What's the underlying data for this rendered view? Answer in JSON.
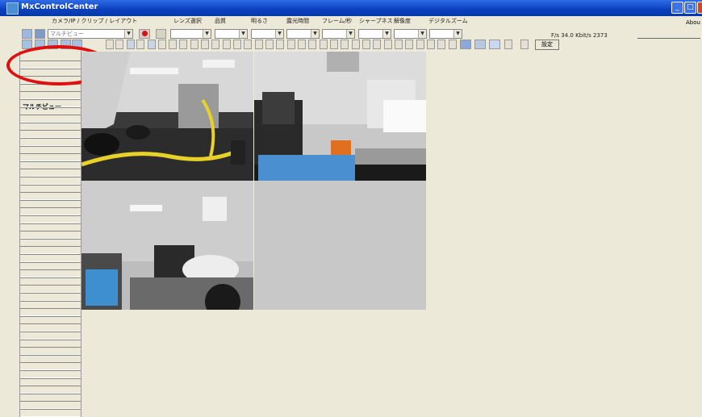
{
  "window": {
    "title": "MxControlCenter",
    "about_label": "Abou"
  },
  "menu": {
    "left": "カメラ/IP / クリップ / レイアウト",
    "headers": [
      "レンズ選択",
      "品質",
      "明るさ",
      "露光時間",
      "フレーム/秒",
      "シャープネス",
      "解像度",
      "デジタルズーム"
    ]
  },
  "toolbar": {
    "view_select_value": "マルチビュー",
    "settings_label": "設定"
  },
  "status": {
    "text": "F/s  34.0   Kbit/s  2373"
  },
  "sidebar": {
    "items": [
      {
        "label": "マルチビュー"
      }
    ]
  },
  "colors": {
    "titlebar": "#0A3FBF",
    "highlight_ring": "#E01010",
    "empty_tile": "#C8C8C8"
  },
  "cameras": [
    "camera-view-1",
    "camera-view-2",
    "camera-view-3",
    "camera-view-empty"
  ]
}
